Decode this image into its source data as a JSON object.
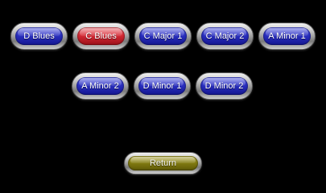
{
  "buttons": [
    {
      "label": "D Blues",
      "state": "default"
    },
    {
      "label": "C Blues",
      "state": "selected"
    },
    {
      "label": "C Major 1",
      "state": "default"
    },
    {
      "label": "C Major 2",
      "state": "default"
    },
    {
      "label": "A Minor 1",
      "state": "default"
    },
    {
      "label": "A Minor 2",
      "state": "default"
    },
    {
      "label": "D Minor 1",
      "state": "default"
    },
    {
      "label": "D Minor 2",
      "state": "default"
    }
  ],
  "return_button": {
    "label": "Return"
  },
  "colors": {
    "background": "#000000",
    "button_default": "#2a2fc0",
    "button_selected": "#d52a35",
    "return_button": "#847d12",
    "bezel": "#bdbdbd"
  }
}
